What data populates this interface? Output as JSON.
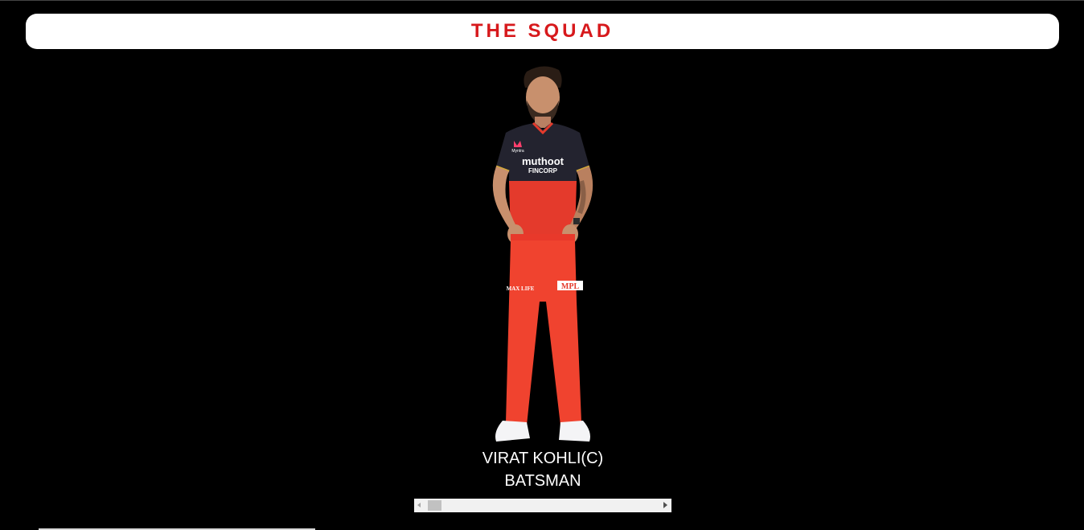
{
  "header": {
    "title": "THE SQUAD",
    "title_color": "#d7191c",
    "background": "#ffffff"
  },
  "player": {
    "name": "VIRAT KOHLI(C)",
    "role": "BATSMAN",
    "image_icon": "player-portrait",
    "jersey_texts": {
      "sponsor_main": "muthoot",
      "sponsor_sub": "FINCORP",
      "kit_brand": "Myntra",
      "pants_left": "MAX LIFE",
      "pants_right": "MPL"
    },
    "colors": {
      "jersey_top": "#23232f",
      "jersey_red": "#e43a2c",
      "pants": "#f0432f",
      "shoes": "#f4f4f6"
    }
  },
  "scrollbar": {
    "left_icon": "arrow-left-icon",
    "right_icon": "arrow-right-icon"
  },
  "page": {
    "background": "#000000"
  }
}
